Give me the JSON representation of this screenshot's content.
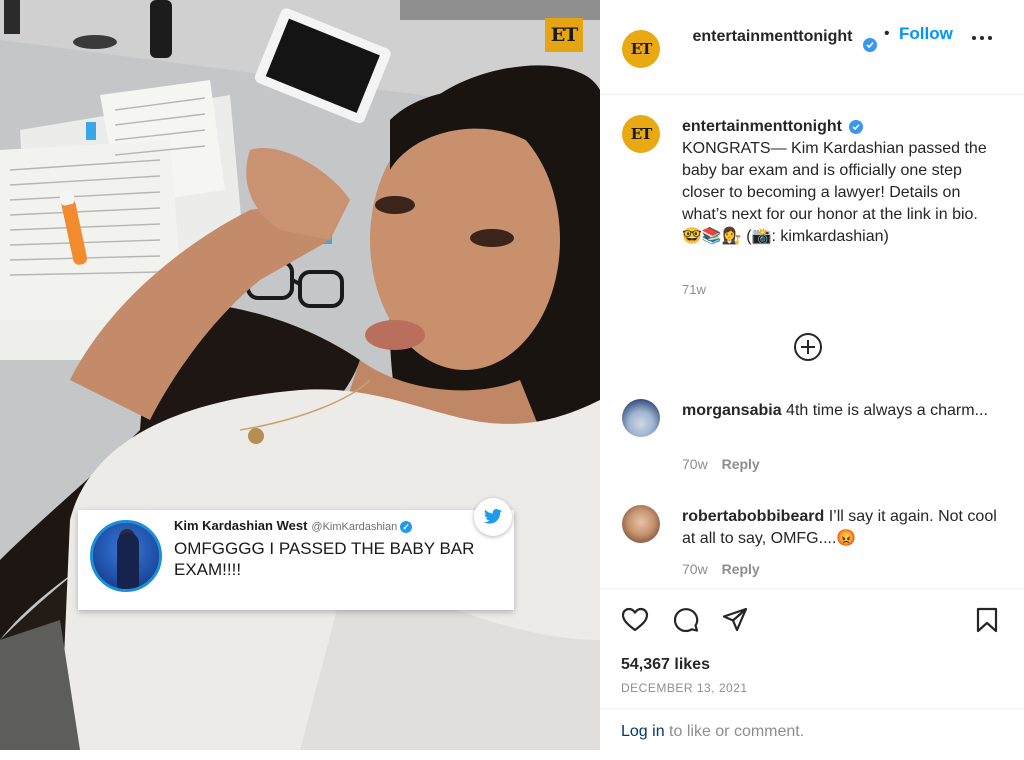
{
  "photo": {
    "et_badge": "ET",
    "tweet": {
      "name": "Kim Kardashian West",
      "handle": "@KimKardashian",
      "text": "OMFGGGG I PASSED THE BABY BAR EXAM!!!!"
    }
  },
  "header": {
    "avatar_text": "ET",
    "username": "entertainmenttonight",
    "separator": "•",
    "follow_label": "Follow"
  },
  "caption": {
    "avatar_text": "ET",
    "username": "entertainmenttonight",
    "text": "KONGRATS— Kim Kardashian passed the baby bar exam and is officially one step closer to becoming a lawyer! Details on what’s next for our honor at the link in bio. 🤓📚👩‍⚖️ (📸: kimkardashian)",
    "time": "71w"
  },
  "comments": [
    {
      "username": "morgansabia",
      "text": "4th time is always a charm...",
      "time": "70w",
      "reply_label": "Reply"
    },
    {
      "username": "robertabobbibeard",
      "text": "I’ll say it again. Not cool at all to say, OMFG....😡",
      "time": "70w",
      "reply_label": "Reply"
    }
  ],
  "stats": {
    "likes": "54,367 likes",
    "date": "DECEMBER 13, 2021"
  },
  "login": {
    "link_label": "Log in",
    "rest": " to like or comment."
  },
  "colors": {
    "follow_blue": "#0095f6",
    "verified_blue": "#3897f0",
    "et_gold": "#e8a912",
    "muted": "#8e8e8e"
  },
  "icons": [
    "verified-icon",
    "more-options-icon",
    "add-circle-icon",
    "heart-icon",
    "comment-icon",
    "share-icon",
    "bookmark-icon",
    "twitter-bird-icon"
  ]
}
